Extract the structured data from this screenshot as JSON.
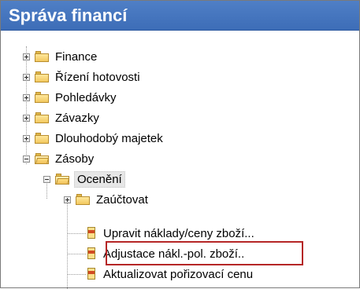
{
  "window": {
    "title": "Správa financí"
  },
  "tree": {
    "items": [
      {
        "label": "Finance",
        "icon": "folder-icon",
        "expander": "plus"
      },
      {
        "label": "Řízení hotovosti",
        "icon": "folder-icon",
        "expander": "plus"
      },
      {
        "label": "Pohledávky",
        "icon": "folder-icon",
        "expander": "plus"
      },
      {
        "label": "Závazky",
        "icon": "folder-icon",
        "expander": "plus"
      },
      {
        "label": "Dlouhodobý majetek",
        "icon": "folder-icon",
        "expander": "plus"
      },
      {
        "label": "Zásoby",
        "icon": "open-folder-icon",
        "expander": "minus"
      },
      {
        "label": "Ocenění",
        "icon": "open-folder-icon",
        "expander": "minus",
        "selected": true
      },
      {
        "label": "Zaúčtovat",
        "icon": "folder-icon",
        "expander": "plus"
      },
      {
        "label": "Upravit náklady/ceny zboží...",
        "icon": "report-icon"
      },
      {
        "label": "Adjustace nákl.-pol. zboží..",
        "icon": "report-icon",
        "highlighted": true,
        "highlight_color": "#b52626"
      },
      {
        "label": "Aktualizovat pořizovací cenu",
        "icon": "report-icon"
      }
    ]
  },
  "colors": {
    "title_bar": "#3d6db7",
    "highlight_border": "#b52626"
  }
}
